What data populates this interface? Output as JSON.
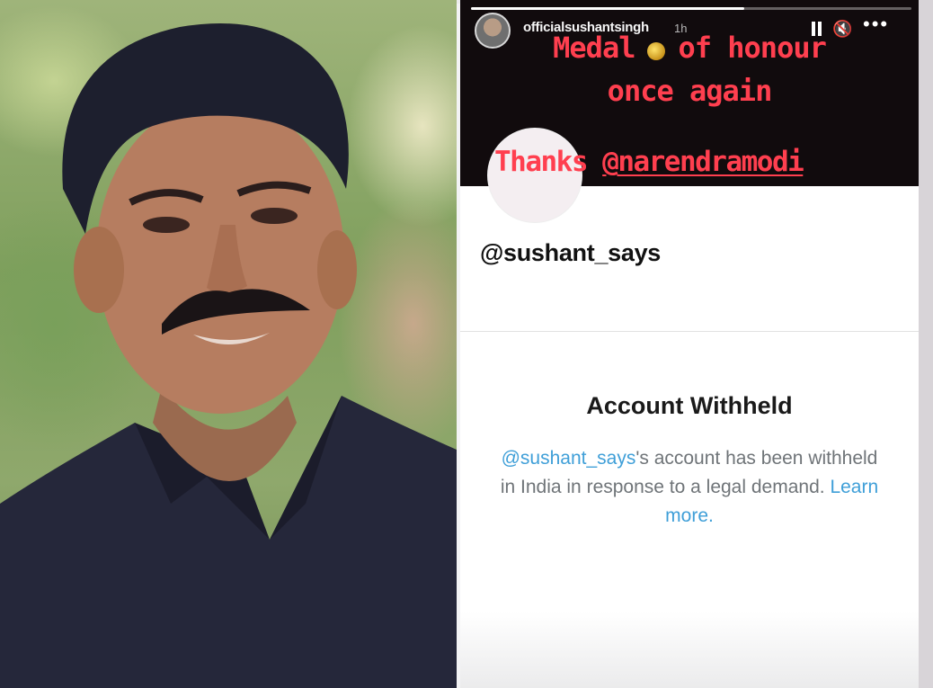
{
  "story": {
    "username": "officialsushantsingh",
    "time": "1h",
    "progress_fraction": 0.62,
    "line1_part1": "Medal",
    "line1_part2": "of honour",
    "line2": "once again",
    "thanks_word": "Thanks",
    "thanks_mention": "@narendramodi",
    "icons": [
      "pause-icon",
      "mute-icon",
      "more-icon",
      "medal-icon"
    ]
  },
  "profile": {
    "handle": "@sushant_says"
  },
  "withheld": {
    "title": "Account Withheld",
    "body_handle": "@sushant_says",
    "body_text_1": "'s account has been withheld in India in response to a legal demand.",
    "learn_more": "Learn more."
  },
  "colors": {
    "story_text": "#ff3f4f",
    "story_bg": "#110b0d",
    "link": "#3f9fd8",
    "body_text": "#6f7478"
  }
}
